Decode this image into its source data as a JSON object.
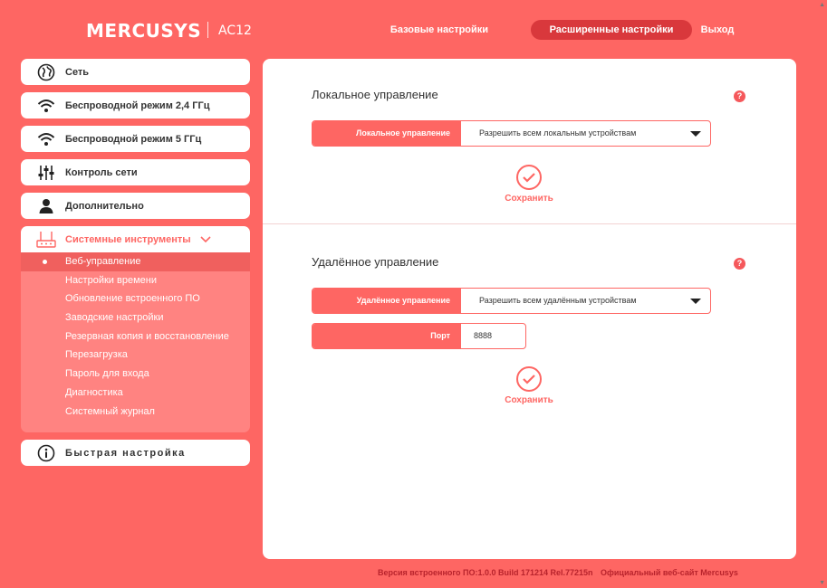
{
  "header": {
    "logo": "MERCUSYS",
    "model": "AC12",
    "nav": {
      "basic": "Базовые настройки",
      "advanced": "Расширенные настройки",
      "exit": "Выход"
    }
  },
  "sidebar": {
    "items": [
      {
        "label": "Сеть",
        "icon": "globe-icon"
      },
      {
        "label": "Беспроводной режим 2,4 ГГц",
        "icon": "wifi-icon"
      },
      {
        "label": "Беспроводной режим 5 ГГц",
        "icon": "wifi-icon"
      },
      {
        "label": "Контроль сети",
        "icon": "sliders-icon"
      },
      {
        "label": "Дополнительно",
        "icon": "user-icon"
      },
      {
        "label": "Системные инструменты",
        "icon": "router-icon"
      }
    ],
    "submenu": [
      "Веб-управление",
      "Настройки времени",
      "Обновление встроенного ПО",
      "Заводские настройки",
      "Резервная копия и восстановление",
      "Перезагрузка",
      "Пароль для входа",
      "Диагностика",
      "Системный журнал"
    ],
    "quick": {
      "label": "Быстрая настройка",
      "icon": "info-icon"
    }
  },
  "local": {
    "title": "Локальное управление",
    "field_label": "Локальное управление",
    "value": "Разрешить всем локальным устройствам",
    "save": "Сохранить"
  },
  "remote": {
    "title": "Удалённое управление",
    "field_label": "Удалённое управление",
    "value": "Разрешить всем удалённым устройствам",
    "port_label": "Порт",
    "port_value": "8888",
    "save": "Сохранить"
  },
  "help_glyph": "?",
  "footer": {
    "firmware": "Версия встроенного ПО:1.0.0 Build 171214 Rel.77215n",
    "site": "Официальный веб-сайт Mercusys"
  },
  "colors": {
    "accent": "#fe6663",
    "active_nav": "#d9383c",
    "submenu": "#ff8381"
  }
}
